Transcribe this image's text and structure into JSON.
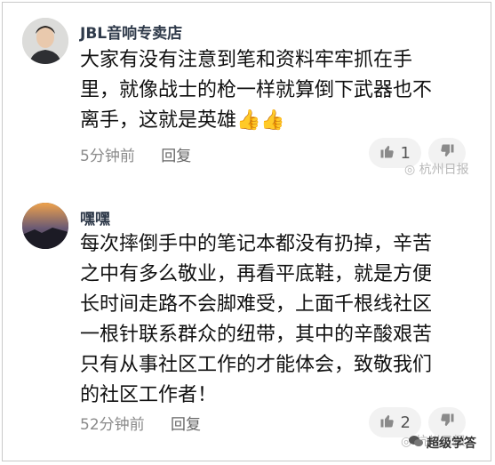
{
  "comments": [
    {
      "username": "JBL音响专卖店",
      "text": "大家有没有注意到笔和资料牢牢抓在手\n里，就像战士的枪一样就算倒下武器也不\n离手，这就是英雄👍👍",
      "time": "5分钟前",
      "reply_label": "回复",
      "likes": "1"
    },
    {
      "username": "嘿嘿",
      "text": "每次摔倒手中的笔记本都没有扔掉，辛苦\n之中有多么敬业，再看平底鞋，就是方便\n长时间走路不会脚难受，上面千根线社区\n一根针联系群众的纽带，其中的辛酸艰苦\n只有从事社区工作的才能体会，致敬我们\n的社区工作者！",
      "time": "52分钟前",
      "reply_label": "回复",
      "likes": "2"
    }
  ],
  "watermark": "杭州日报",
  "brand": "超级学答",
  "icons": {
    "like": "thumbs-up-icon",
    "dislike": "thumbs-down-icon",
    "weibo": "weibo-icon"
  }
}
